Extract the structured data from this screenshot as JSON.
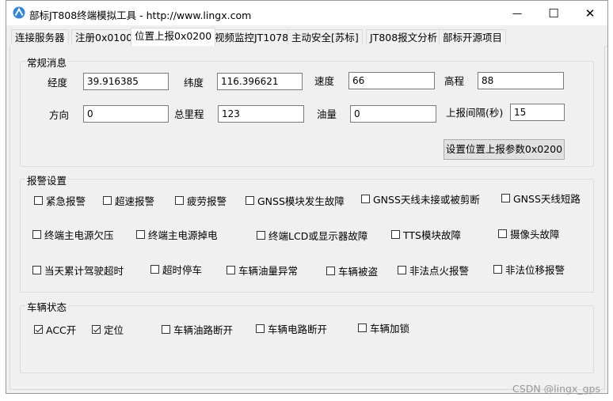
{
  "window": {
    "title": "部标JT808终端模拟工具 - http://www.lingx.com",
    "controls": {
      "minimize": "—",
      "maximize": "☐",
      "close": "✕"
    }
  },
  "tabs": [
    "连接服务器",
    "注册0x0100",
    "位置上报0x0200",
    "视频监控JT1078",
    "主动安全[苏标]",
    "JT808报文分析",
    "部标开源项目"
  ],
  "active_tab": "位置上报0x0200",
  "regular": {
    "title": "常规消息",
    "fields": [
      {
        "label": "经度",
        "value": "39.916385"
      },
      {
        "label": "纬度",
        "value": "116.396621"
      },
      {
        "label": "速度",
        "value": "66"
      },
      {
        "label": "高程",
        "value": "88"
      },
      {
        "label": "方向",
        "value": "0"
      },
      {
        "label": "总里程",
        "value": "123"
      },
      {
        "label": "油量",
        "value": "0"
      },
      {
        "label": "上报间隔(秒)",
        "value": "15"
      }
    ],
    "button": "设置位置上报参数0x0200"
  },
  "alarm": {
    "title": "报警设置",
    "items": [
      {
        "label": "紧急报警",
        "checked": false
      },
      {
        "label": "超速报警",
        "checked": false
      },
      {
        "label": "疲劳报警",
        "checked": false
      },
      {
        "label": "GNSS模块发生故障",
        "checked": false
      },
      {
        "label": "GNSS天线未接或被剪断",
        "checked": false
      },
      {
        "label": "GNSS天线短路",
        "checked": false
      },
      {
        "label": "终端主电源欠压",
        "checked": false
      },
      {
        "label": "终端主电源掉电",
        "checked": false
      },
      {
        "label": "终端LCD或显示器故障",
        "checked": false
      },
      {
        "label": "TTS模块故障",
        "checked": false
      },
      {
        "label": "摄像头故障",
        "checked": false
      },
      {
        "label": "当天累计驾驶超时",
        "checked": false
      },
      {
        "label": "超时停车",
        "checked": false
      },
      {
        "label": "车辆油量异常",
        "checked": false
      },
      {
        "label": "车辆被盗",
        "checked": false
      },
      {
        "label": "非法点火报警",
        "checked": false
      },
      {
        "label": "非法位移报警",
        "checked": false
      }
    ]
  },
  "vehicle": {
    "title": "车辆状态",
    "items": [
      {
        "label": "ACC开",
        "checked": true
      },
      {
        "label": "定位",
        "checked": true
      },
      {
        "label": "车辆油路断开",
        "checked": false
      },
      {
        "label": "车辆电路断开",
        "checked": false
      },
      {
        "label": "车辆加锁",
        "checked": false
      }
    ]
  },
  "watermark": "CSDN @lingx_gps",
  "colors": {
    "window_bg": "#f0f0f0",
    "icon_blue": "#2e86de",
    "button_bg": "#e1e1e1"
  }
}
